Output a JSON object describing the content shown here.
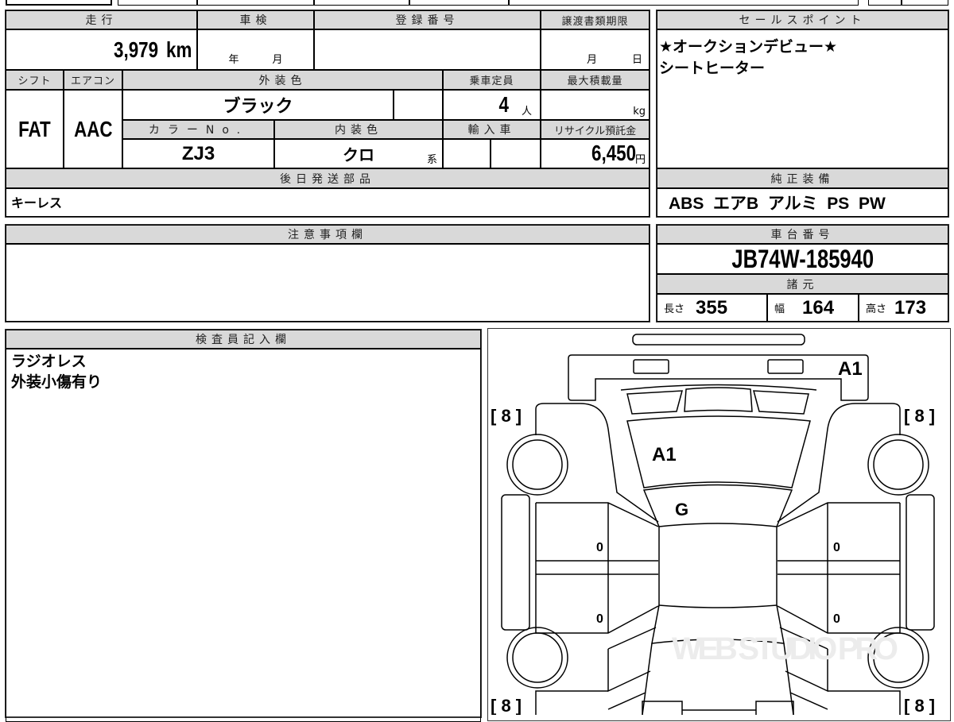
{
  "summary": {
    "headers": {
      "mileage": "走行",
      "inspection": "車検",
      "registration": "登録番号",
      "transfer_deadline": "譲渡書類期限"
    },
    "mileage": "3,979",
    "mileage_unit": "km",
    "inspection_year": "年",
    "inspection_month": "月",
    "deadline_month": "月",
    "deadline_day": "日"
  },
  "specs": {
    "headers": {
      "shift": "シフト",
      "aircon": "エアコン",
      "exterior_color": "外装色",
      "capacity": "乗車定員",
      "max_load": "最大積載量",
      "color_no": "カラーNo.",
      "interior_color": "内装色",
      "import": "輸入車",
      "recycle_fee": "リサイクル預託金"
    },
    "shift": "FAT",
    "aircon": "AAC",
    "exterior_color": "ブラック",
    "capacity": "4",
    "capacity_unit": "人",
    "max_load_unit": "kg",
    "color_no": "ZJ3",
    "interior_color": "クロ",
    "interior_suffix": "系",
    "recycle_fee": "6,450",
    "recycle_unit": "円"
  },
  "later_parts": {
    "header": "後日発送部品",
    "value": "キーレス"
  },
  "sales_points": {
    "header": "セールスポイント",
    "lines": [
      "★オークションデビュー★",
      "シートヒーター"
    ]
  },
  "standard_equipment": {
    "header": "純正装備",
    "value": "ABS  エアB  アルミ  PS  PW"
  },
  "notes": {
    "header": "注意事項欄"
  },
  "chassis": {
    "header": "車台番号",
    "value": "JB74W-185940"
  },
  "dimensions": {
    "header": "諸元",
    "length_label": "長さ",
    "length": "355",
    "width_label": "幅",
    "width": "164",
    "height_label": "高さ",
    "height": "173"
  },
  "inspector": {
    "header": "検査員記入欄",
    "lines": [
      "ラジオレス",
      "外装小傷有り"
    ]
  },
  "diagram": {
    "front_bumper": "A1",
    "hood": "A1",
    "windshield": "G",
    "front_left_door": "0",
    "rear_left_door": "0",
    "front_right_door": "0",
    "rear_right_door": "0",
    "tire_fl": "[ 8 ]",
    "tire_fr": "[ 8 ]",
    "tire_rl": "[ 8 ]",
    "tire_rr": "[ 8 ]",
    "watermark": "WEB STUDIO PRO"
  }
}
